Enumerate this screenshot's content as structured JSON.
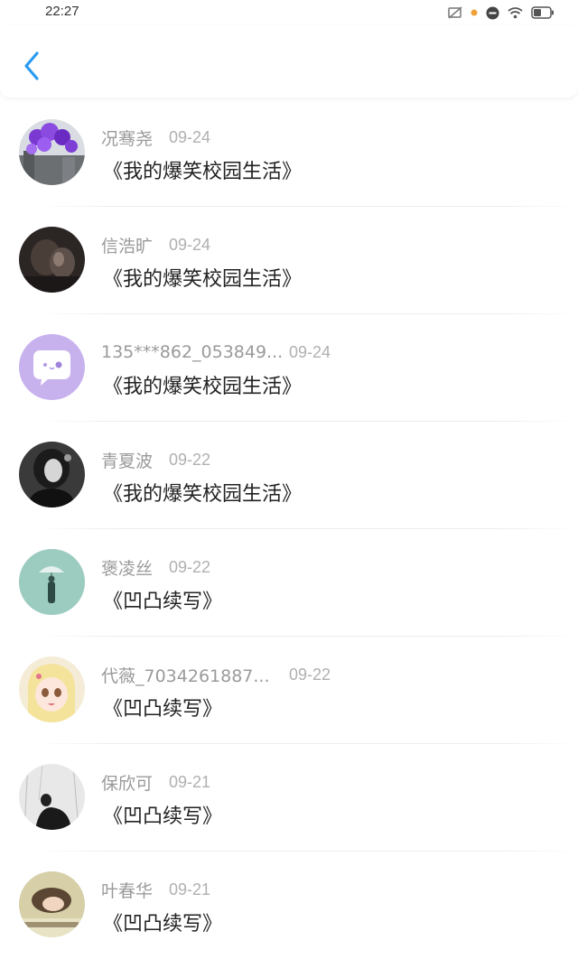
{
  "status_bar": {
    "time": "22:27",
    "icons": [
      "sim-off-icon",
      "notification-dot-icon",
      "do-not-disturb-icon",
      "wifi-icon",
      "battery-icon"
    ]
  },
  "header": {
    "back_icon": "chevron-left-icon",
    "accent_color": "#2a9bf0"
  },
  "items": [
    {
      "name": "况骞尧",
      "date": "09-24",
      "title": "《我的爆笑校园生活》",
      "avatar": "purple-balloons"
    },
    {
      "name": "信浩旷",
      "date": "09-24",
      "title": "《我的爆笑校园生活》",
      "avatar": "dark-portrait"
    },
    {
      "name": "135***862_053849...",
      "date": "09-24",
      "title": "《我的爆笑校园生活》",
      "avatar": "default-purple-chat"
    },
    {
      "name": "青夏波",
      "date": "09-22",
      "title": "《我的爆笑校园生活》",
      "avatar": "bw-portrait"
    },
    {
      "name": "褒凌丝",
      "date": "09-22",
      "title": "《凹凸续写》",
      "avatar": "umbrella-rain"
    },
    {
      "name": "代薇_7034261887...",
      "date": "09-22",
      "title": "《凹凸续写》",
      "avatar": "anime-girl"
    },
    {
      "name": "保欣可",
      "date": "09-21",
      "title": "《凹凸续写》",
      "avatar": "bw-snow"
    },
    {
      "name": "叶春华",
      "date": "09-21",
      "title": "《凹凸续写》",
      "avatar": "sleeping-girl"
    }
  ]
}
